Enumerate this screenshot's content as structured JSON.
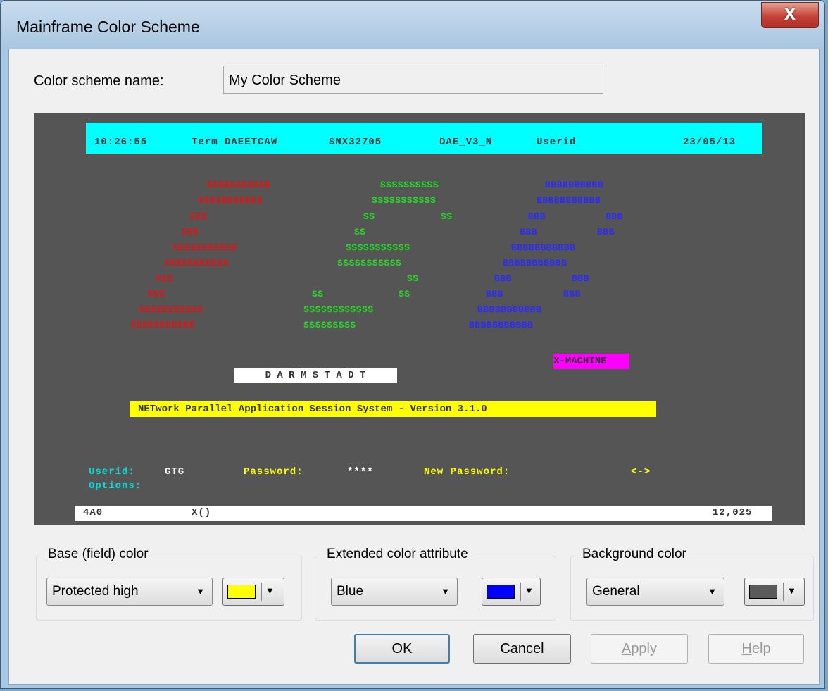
{
  "window": {
    "title": "Mainframe Color Scheme",
    "close_label": "X"
  },
  "scheme": {
    "label": "Color scheme name:",
    "value": "My Color Scheme"
  },
  "preview": {
    "header": {
      "time": "10:26:55",
      "term": "Term DAEETCAW",
      "snx": "SNX32705",
      "dae": "DAE_V3_N",
      "userid": "Userid",
      "date": "23/05/13"
    },
    "big_e": [
      "EEEEEEEEEEE",
      "EEEEEEEEEEE",
      "EEE",
      "EEE",
      "EEEEEEEEEEE",
      "EEEEEEEEEEE",
      "EEE",
      "EEE",
      "EEEEEEEEEEE",
      "EEEEEEEEEEE"
    ],
    "big_s": [
      "SSSSSSSSSS",
      "SSSSSSSSSSS",
      "SS",
      "SS",
      "SS",
      "SSSSSSSSSSS",
      "SSSSSSSSSSS",
      "SS",
      "SS",
      "SS",
      "SSSSSSSSSSSS",
      "SSSSSSSSS"
    ],
    "big_b": [
      "BBBBBBBBBB",
      "BBBBBBBBBBB",
      "BBB",
      "BBB",
      "BBB",
      "BBB",
      "BBBBBBBBBBB",
      "BBBBBBBBBBB",
      "BBB",
      "BBB",
      "BBB",
      "BBB",
      "BBBBBBBBBBB",
      "BBBBBBBBBBB"
    ],
    "machine": "X-MACHINE",
    "darmstadt": "D A R M S T A D T",
    "version": "NETwork Parallel Application Session System - Version 3.1.0",
    "userid_label": "Userid:",
    "userid_value": "GTG",
    "password_label": "Password:",
    "password_value": "****",
    "newpass_label": "New Password:",
    "arrow": "<->",
    "options_label": "Options:",
    "status_left": "4A0",
    "status_mid": "X()",
    "status_right": "12,025"
  },
  "base_group": {
    "label_u": "B",
    "label_rest": "ase (field) color",
    "value": "Protected high",
    "swatch_color": "#ffff00"
  },
  "ext_group": {
    "label_u": "E",
    "label_rest": "xtended color attribute",
    "value": "Blue",
    "swatch_color": "#0000ff"
  },
  "bg_group": {
    "label_pre": "Back",
    "label_u": "g",
    "label_rest": "round color",
    "value": "General",
    "swatch_color": "#5a5a5a"
  },
  "buttons": {
    "ok": "OK",
    "cancel": "Cancel",
    "apply_u": "A",
    "apply_rest": "pply",
    "help_u": "H",
    "help_rest": "elp"
  },
  "colors": {
    "terminal_bg": "#555555",
    "header": "#00ffff",
    "label_cyan": "#00e0e0",
    "label_yellow": "#ffff00",
    "magenta": "#ff00ff"
  }
}
